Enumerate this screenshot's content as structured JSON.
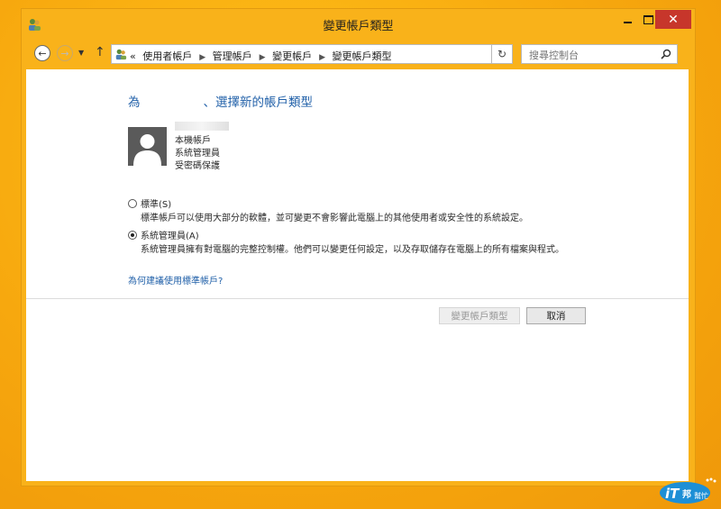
{
  "window": {
    "title": "變更帳戶類型",
    "controls": {
      "minimize": "minimize",
      "maximize": "maximize",
      "close": "✕"
    }
  },
  "toolbar": {
    "breadcrumb_prefix": "«",
    "breadcrumbs": [
      "使用者帳戶",
      "管理帳戶",
      "變更帳戶",
      "變更帳戶類型"
    ],
    "search_placeholder": "搜尋控制台"
  },
  "main": {
    "heading_prefix": "為",
    "heading_suffix": "、選擇新的帳戶類型",
    "account": {
      "lines": [
        "本機帳戶",
        "系統管理員",
        "受密碼保護"
      ]
    },
    "options": [
      {
        "label": "標準(S)",
        "description": "標準帳戶可以使用大部分的軟體，並可變更不會影響此電腦上的其他使用者或安全性的系統設定。",
        "selected": false
      },
      {
        "label": "系統管理員(A)",
        "description": "系統管理員擁有對電腦的完整控制權。他們可以變更任何設定，以及存取儲存在電腦上的所有檔案與程式。",
        "selected": true
      }
    ],
    "help_link": "為何建議使用標準帳戶?",
    "buttons": {
      "change": "變更帳戶類型",
      "cancel": "取消"
    }
  },
  "colors": {
    "desktop": "#f7a80e",
    "window_frame": "#f9b21a",
    "close_button": "#c7362b",
    "link": "#1f5fa8"
  }
}
